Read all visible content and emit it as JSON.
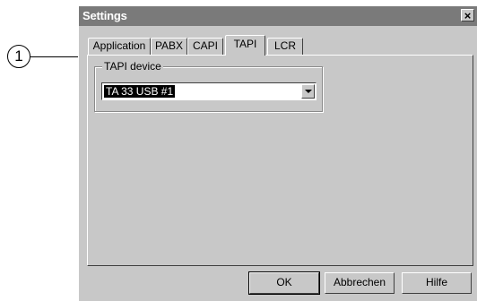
{
  "callout": {
    "number": "1"
  },
  "window": {
    "title": "Settings",
    "close_glyph": "×"
  },
  "tabs": [
    {
      "label": "Application"
    },
    {
      "label": "PABX"
    },
    {
      "label": "CAPI"
    },
    {
      "label": "TAPI",
      "active": true
    },
    {
      "label": "LCR"
    }
  ],
  "tapi": {
    "group_label": "TAPI device",
    "device_value": "TA 33 USB #1",
    "dropdown_icon": "chevron-down-icon"
  },
  "buttons": {
    "ok": "OK",
    "cancel": "Abbrechen",
    "help": "Hilfe"
  },
  "colors": {
    "face": "#c8c8c8",
    "titlebar": "#7a7a7a",
    "selection": "#000000"
  }
}
